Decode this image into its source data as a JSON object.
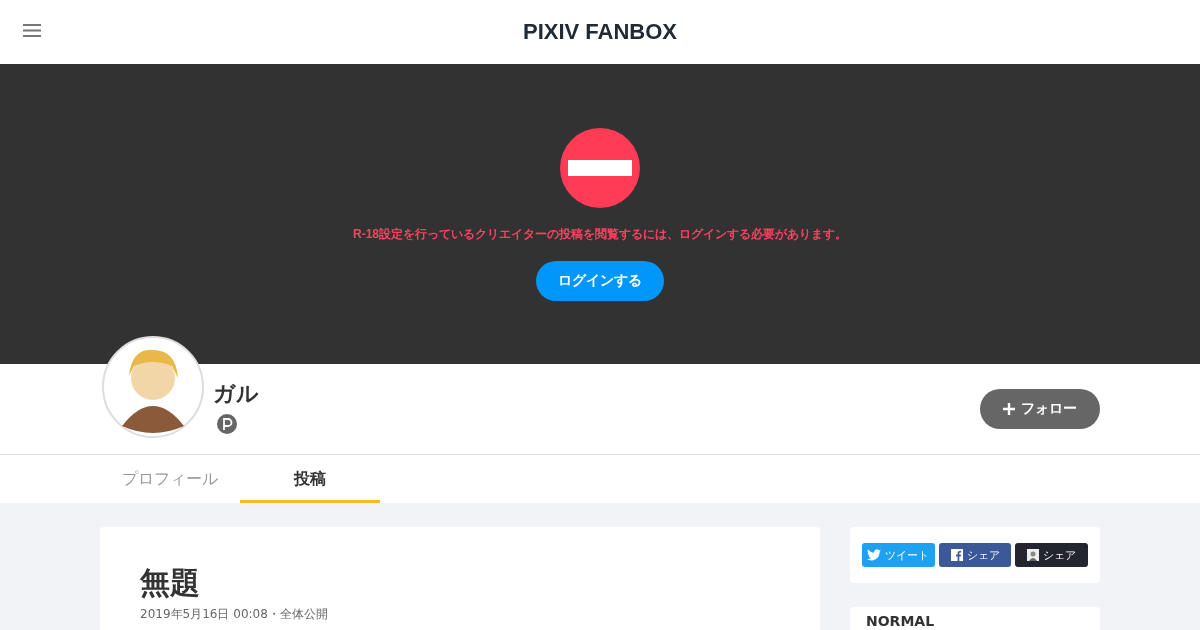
{
  "header": {
    "logo": "PIXIV FANBOX"
  },
  "notice": {
    "message": "R-18設定を行っているクリエイターの投稿を閲覧するには、ログインする必要があります。",
    "login_button": "ログインする"
  },
  "creator": {
    "name": "ガル",
    "follow_button": "フォロー"
  },
  "tabs": [
    {
      "label": "プロフィール",
      "selected": false
    },
    {
      "label": "投稿",
      "selected": true
    }
  ],
  "post": {
    "title": "無題",
    "meta": "2019年5月16日 00:08・全体公開"
  },
  "share_buttons": [
    {
      "kind": "twitter",
      "label": "ツイート"
    },
    {
      "kind": "facebook",
      "label": "シェア"
    },
    {
      "kind": "fanbox",
      "label": "シェア"
    }
  ],
  "plan_card": {
    "title": "NORMAL"
  }
}
